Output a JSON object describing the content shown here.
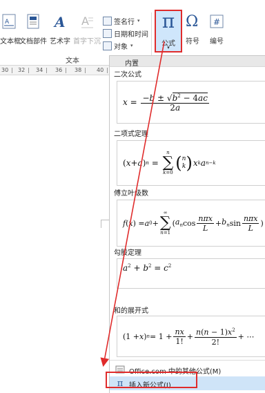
{
  "ribbon": {
    "textbox_label": "文本框",
    "docparts_label": "文档部件",
    "wordart_label": "艺术字",
    "dropcap_label": "首字下沉",
    "signature_label": "签名行",
    "datetime_label": "日期和时间",
    "object_label": "对象",
    "formula_label": "公式",
    "symbol_label": "符号",
    "number_label": "编号",
    "group_text_label": "文本"
  },
  "ruler": {
    "ticks": [
      "30",
      "32",
      "34",
      "36",
      "38",
      "40"
    ]
  },
  "gallery": {
    "header": "内置",
    "categories": [
      "二次公式",
      "二项式定理",
      "傅立叶级数",
      "勾股定理",
      "和的展开式"
    ],
    "equations": [
      "x = (−b ± √(b² − 4ac)) / 2a",
      "(x + a)ⁿ = Σ_{k=0}^{n} C(n,k) xᵏ aⁿ⁻ᵏ",
      "f(x) = a₀ + Σ_{n=1}^{∞} (aₙ cos(nπx/L) + bₙ sin(nπx/L))",
      "a² + b² = c²",
      "(1 + x)ⁿ = 1 + nx/1! + n(n−1)x²/2! + ⋯"
    ],
    "menu": {
      "more_label": "Office.com 中的其他公式(M)",
      "insert_label": "插入新公式(I)"
    }
  },
  "colors": {
    "highlight_border": "#e02b2b",
    "accent_blue": "#2b5797",
    "selected_bg": "#cfe6fb"
  }
}
